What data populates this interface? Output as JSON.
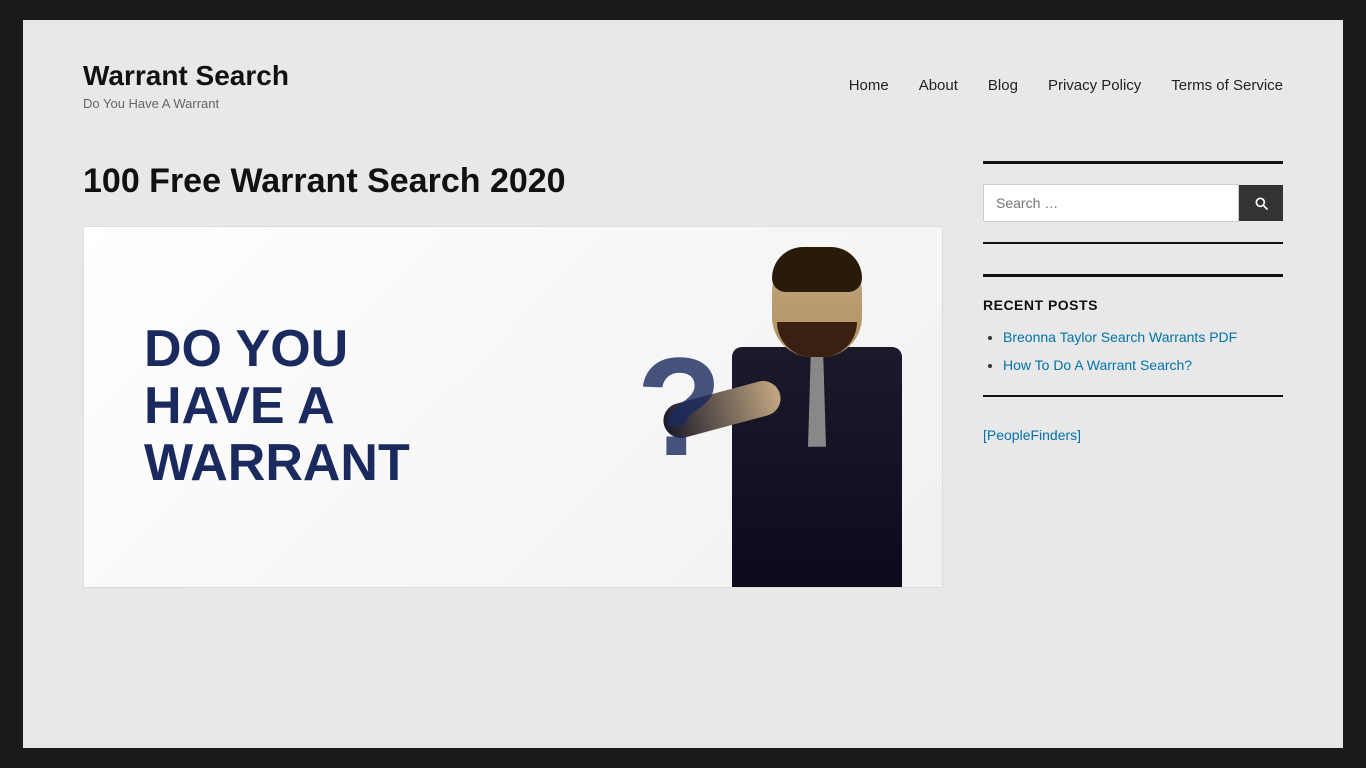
{
  "site": {
    "title": "Warrant Search",
    "description": "Do You Have A Warrant",
    "background_color": "#1a1a1a",
    "content_background": "#e8e8e8"
  },
  "navigation": {
    "items": [
      {
        "label": "Home",
        "url": "#"
      },
      {
        "label": "About",
        "url": "#"
      },
      {
        "label": "Blog",
        "url": "#"
      },
      {
        "label": "Privacy Policy",
        "url": "#"
      },
      {
        "label": "Terms of Service",
        "url": "#"
      }
    ]
  },
  "main_post": {
    "title": "100 Free Warrant Search 2020",
    "image_alt": "Do You Have A Warrant",
    "image_text_line1": "DO YOU",
    "image_text_line2": "HAVE A",
    "image_text_line3": "WARRANT"
  },
  "sidebar": {
    "search": {
      "placeholder": "Search …",
      "button_label": "🔍"
    },
    "recent_posts": {
      "heading": "RECENT POSTS",
      "items": [
        {
          "label": "Breonna Taylor Search Warrants PDF",
          "url": "#"
        },
        {
          "label": "How To Do A Warrant Search?",
          "url": "#"
        }
      ]
    },
    "people_finders": {
      "label": "PeopleFinders"
    }
  }
}
